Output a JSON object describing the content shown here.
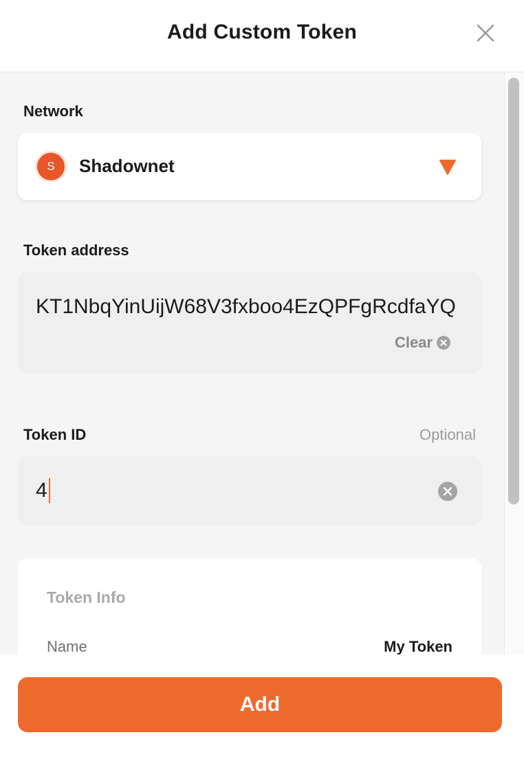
{
  "header": {
    "title": "Add Custom Token",
    "close_icon": "close-icon"
  },
  "network": {
    "label": "Network",
    "avatar_letter": "S",
    "selected": "Shadownet",
    "avatar_color": "#e8562a",
    "caret_icon": "triangle-down-icon"
  },
  "token_address": {
    "label": "Token address",
    "value": "KT1NbqYinUijW68V3fxboo4EzQPFgRcdfaYQ",
    "clear_label": "Clear"
  },
  "token_id": {
    "label": "Token ID",
    "optional_label": "Optional",
    "value": "4"
  },
  "token_info": {
    "title": "Token Info",
    "rows": [
      {
        "label": "Name",
        "value": "My Token"
      }
    ]
  },
  "footer": {
    "add_label": "Add"
  },
  "colors": {
    "accent": "#ee6a2c",
    "field_bg": "#efefef",
    "panel_bg": "#f5f5f5"
  }
}
